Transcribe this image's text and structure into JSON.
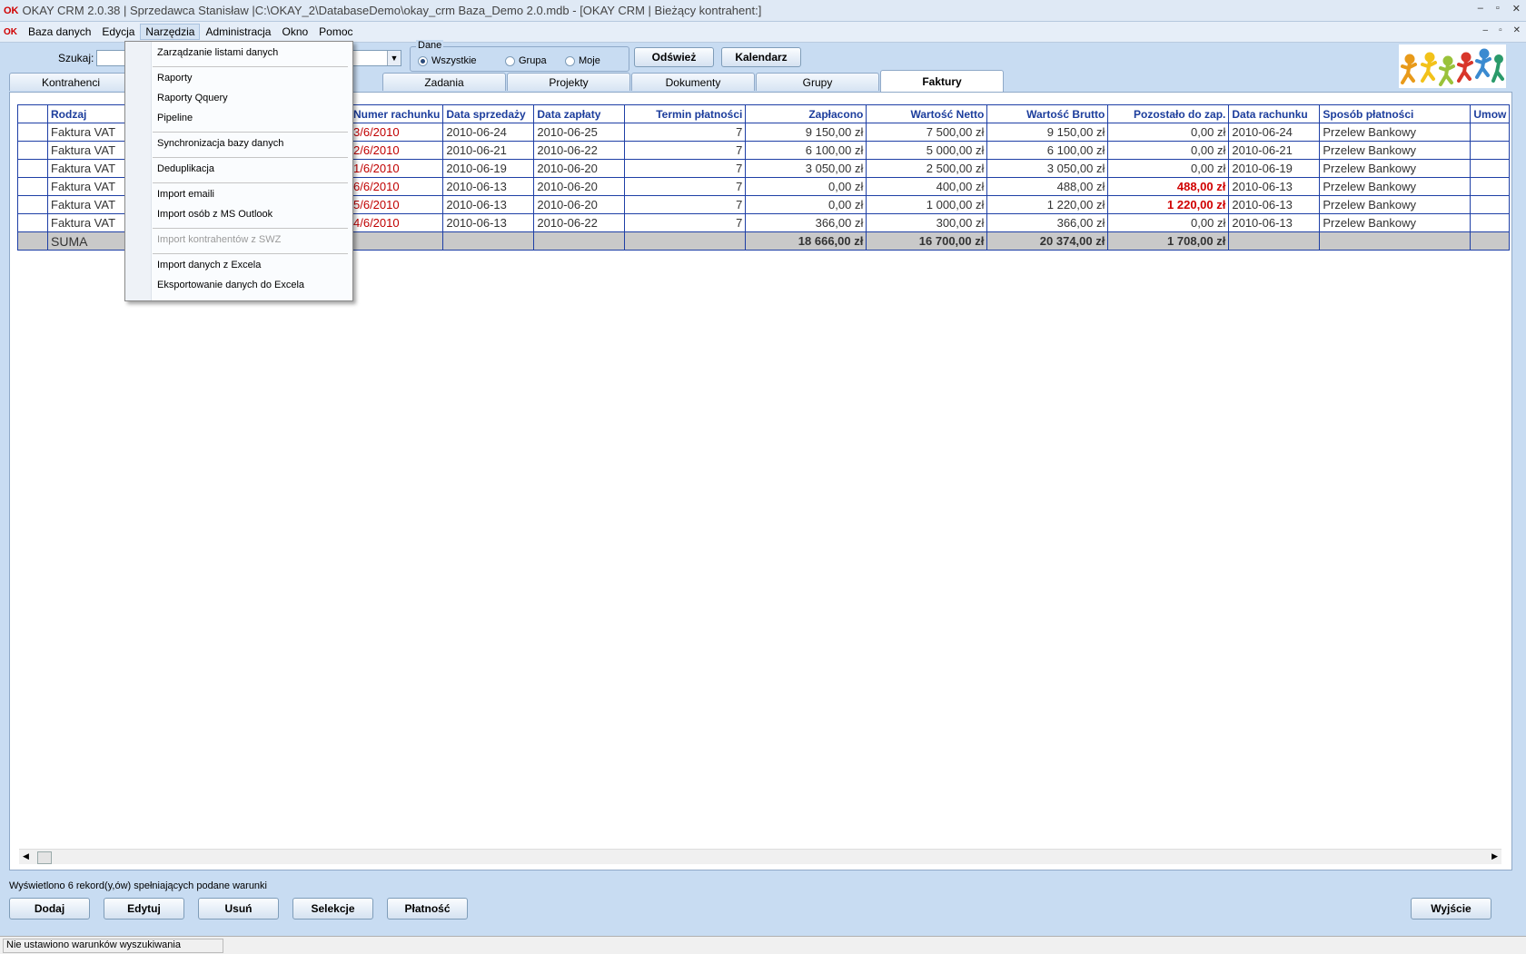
{
  "titlebar": {
    "logo_ok": "OK",
    "title": "OKAY CRM 2.0.38 | Sprzedawca Stanisław |C:\\OKAY_2\\DatabaseDemo\\okay_crm Baza_Demo 2.0.mdb - [OKAY CRM | Bieżący kontrahent:]",
    "min": "–",
    "max": "▫",
    "close": "✕"
  },
  "menubar": {
    "logo": "OK",
    "items": [
      "Baza danych",
      "Edycja",
      "Narzędzia",
      "Administracja",
      "Okno",
      "Pomoc"
    ],
    "mdi_min": "–",
    "mdi_restore": "▫",
    "mdi_close": "✕"
  },
  "toolbar": {
    "search_label": "Szukaj:",
    "dane_legend": "Dane",
    "opt_all": "Wszystkie",
    "opt_group": "Grupa",
    "opt_mine": "Moje",
    "refresh": "Odśwież",
    "calendar": "Kalendarz"
  },
  "tabs": [
    "Kontrahenci",
    "Zadania",
    "Projekty",
    "Dokumenty",
    "Grupy",
    "Faktury"
  ],
  "table": {
    "headers": [
      "Rodzaj",
      "Numer rachunku",
      "Data sprzedaży",
      "Data zapłaty",
      "Termin płatności",
      "Zapłacono",
      "Wartość Netto",
      "Wartość Brutto",
      "Pozostało do zap.",
      "Data rachunku",
      "Sposób płatności",
      "Umow"
    ],
    "rows": [
      [
        "Faktura VAT",
        "3/6/2010",
        "2010-06-24",
        "2010-06-25",
        "7",
        "9 150,00 zł",
        "7 500,00 zł",
        "9 150,00 zł",
        "0,00 zł",
        "2010-06-24",
        "Przelew Bankowy",
        ""
      ],
      [
        "Faktura VAT",
        "2/6/2010",
        "2010-06-21",
        "2010-06-22",
        "7",
        "6 100,00 zł",
        "5 000,00 zł",
        "6 100,00 zł",
        "0,00 zł",
        "2010-06-21",
        "Przelew Bankowy",
        ""
      ],
      [
        "Faktura VAT",
        "1/6/2010",
        "2010-06-19",
        "2010-06-20",
        "7",
        "3 050,00 zł",
        "2 500,00 zł",
        "3 050,00 zł",
        "0,00 zł",
        "2010-06-19",
        "Przelew Bankowy",
        ""
      ],
      [
        "Faktura VAT",
        "6/6/2010",
        "2010-06-13",
        "2010-06-20",
        "7",
        "0,00 zł",
        "400,00 zł",
        "488,00 zł",
        "488,00 zł",
        "2010-06-13",
        "Przelew Bankowy",
        ""
      ],
      [
        "Faktura VAT",
        "5/6/2010",
        "2010-06-13",
        "2010-06-20",
        "7",
        "0,00 zł",
        "1 000,00 zł",
        "1 220,00 zł",
        "1 220,00 zł",
        "2010-06-13",
        "Przelew Bankowy",
        ""
      ],
      [
        "Faktura VAT",
        "4/6/2010",
        "2010-06-13",
        "2010-06-22",
        "7",
        "366,00 zł",
        "300,00 zł",
        "366,00 zł",
        "0,00 zł",
        "2010-06-13",
        "Przelew Bankowy",
        ""
      ]
    ],
    "sum": {
      "label": "SUMA",
      "paid": "18 666,00 zł",
      "net": "16 700,00 zł",
      "gross": "20 374,00 zł",
      "remaining": "1 708,00 zł"
    }
  },
  "dropdown": {
    "items": [
      "Zarządzanie listami danych",
      "Raporty",
      "Raporty Qquery",
      "Pipeline",
      "Synchronizacja bazy danych",
      "Deduplikacja",
      "Import emaili",
      "Import osób z MS Outlook",
      "Import kontrahentów z SWZ",
      "Import danych z Excela",
      "Eksportowanie danych do Excela"
    ]
  },
  "footer": {
    "records_msg": "Wyświetlono 6 rekord(y,ów) spełniających podane warunki",
    "add": "Dodaj",
    "edit": "Edytuj",
    "delete": "Usuń",
    "selections": "Selekcje",
    "payment": "Płatność",
    "exit": "Wyjście",
    "status": "Nie ustawiono warunków wyszukiwania"
  },
  "colors": {
    "header_text": "#1c3d9c",
    "grid_border": "#1e3fa6",
    "overdue": "#d00000",
    "background": "#c8dcf2"
  }
}
